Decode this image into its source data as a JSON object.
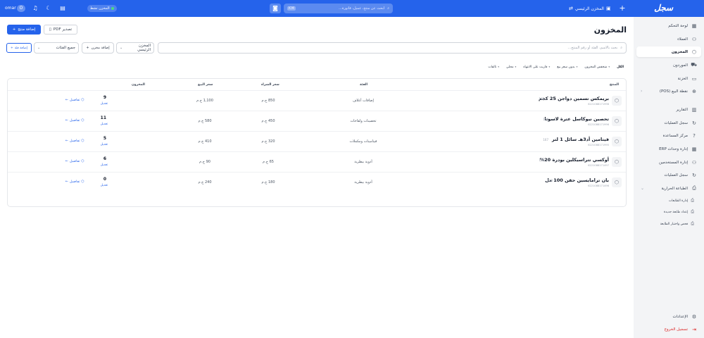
{
  "topbar": {
    "logo": "سجل",
    "plus": "+",
    "store_label": "المخزن الرئيسي",
    "store_icon": "storefront-icon",
    "search_placeholder": "ابحث عن منتج، عميل، فاتورة...",
    "search_kbd": "⌘K",
    "active_label": "المخزن نشط",
    "user_name": "omar",
    "avatar_text": "O",
    "colors": {
      "bar": "#2563eb"
    }
  },
  "sidebar": {
    "items": [
      {
        "label": "لوحة التحكم",
        "icon": "dashboard-icon"
      },
      {
        "label": "العملاء",
        "icon": "users-icon"
      },
      {
        "label": "المخزون",
        "icon": "box-icon",
        "active": true
      },
      {
        "label": "الموردون",
        "icon": "truck-icon"
      },
      {
        "label": "الخزنة",
        "icon": "wallet-icon"
      },
      {
        "label": "نقطة البيع (POS)",
        "icon": "cart-icon"
      },
      {
        "label": "التقارير",
        "icon": "chart-icon"
      },
      {
        "label": "سجل العمليات",
        "icon": "refresh-icon"
      },
      {
        "label": "مركز المساعدة",
        "icon": "help-icon"
      },
      {
        "label": "إدارة وحدات ERP",
        "icon": "grid-icon"
      },
      {
        "label": "إدارة المستخدمين",
        "icon": "user-group-icon"
      },
      {
        "label": "سجل العمليات",
        "icon": "refresh-icon"
      },
      {
        "label": "الطباعة الحرارية",
        "icon": "printer-icon"
      }
    ],
    "sub_items": [
      {
        "label": "إدارة الطابعات"
      },
      {
        "label": "إعداد طابعة جديدة"
      },
      {
        "label": "فحص واختبار الطابعة"
      }
    ],
    "settings_label": "الإعدادات",
    "logout_label": "تسجيل الخروج"
  },
  "main": {
    "title": "المخزون",
    "add_product_label": "إضافة منتج",
    "export_pdf_label": "تصدير PDF",
    "search_placeholder": "بحث بالاسم، الفئة أو رقم المنتج...",
    "store_select_value": "المخزن الرئيسي",
    "add_store_label": "إضافة مخزن",
    "category_select_value": "جميع الفئات",
    "add_category_label": "إضافة فئة",
    "filters": [
      "الكل",
      "منخفض المخزون",
      "بدون سعر بيع",
      "قاربت على الانتهاء",
      "محلي",
      "تالفات"
    ],
    "columns": {
      "product": "المنتج",
      "category": "الفئة",
      "buy_price": "سعر الشراء",
      "sell_price": "سعر البيع",
      "stock": "المخزون"
    },
    "rows": [
      {
        "name": "بريمكس تسمين دواجن 25 كجم",
        "id": "119",
        "sku": "6221088171998",
        "category": "إضافات أعلاف",
        "buy": "850 ج.م",
        "sell": "1,100 ج.م",
        "qty": "9",
        "edit": "تعديل",
        "details": "تفاصيل"
      },
      {
        "name": "تحصين نيوكاسل عترة لاسوتا",
        "id": "154",
        "sku": "6221088171996",
        "category": "تحصينات ولقاحات",
        "buy": "450 ج.م",
        "sell": "580 ج.م",
        "qty": "11",
        "edit": "تعديل",
        "details": "تفاصيل"
      },
      {
        "name": "فيتامين أد3هـ سائل 1 لتر",
        "id": "167",
        "sku": "6221088171995",
        "category": "فيتامينات ومكملات",
        "buy": "320 ج.م",
        "sell": "410 ج.م",
        "qty": "5",
        "edit": "تعديل",
        "details": "تفاصيل"
      },
      {
        "name": "أوكسي تتراسيكلين بودرة 20%",
        "id": "178",
        "sku": "6221088171497",
        "category": "أدوية بيطرية",
        "buy": "65 ج.م",
        "sell": "90 ج.م",
        "qty": "6",
        "edit": "تعديل",
        "details": "تفاصيل"
      },
      {
        "name": "بان ترامايسين حقن 100 مل",
        "id": "118",
        "sku": "6221088171496",
        "category": "أدوية بيطرية",
        "buy": "180 ج.م",
        "sell": "240 ج.م",
        "qty": "0",
        "edit": "تعديل",
        "details": "تفاصيل"
      }
    ]
  }
}
